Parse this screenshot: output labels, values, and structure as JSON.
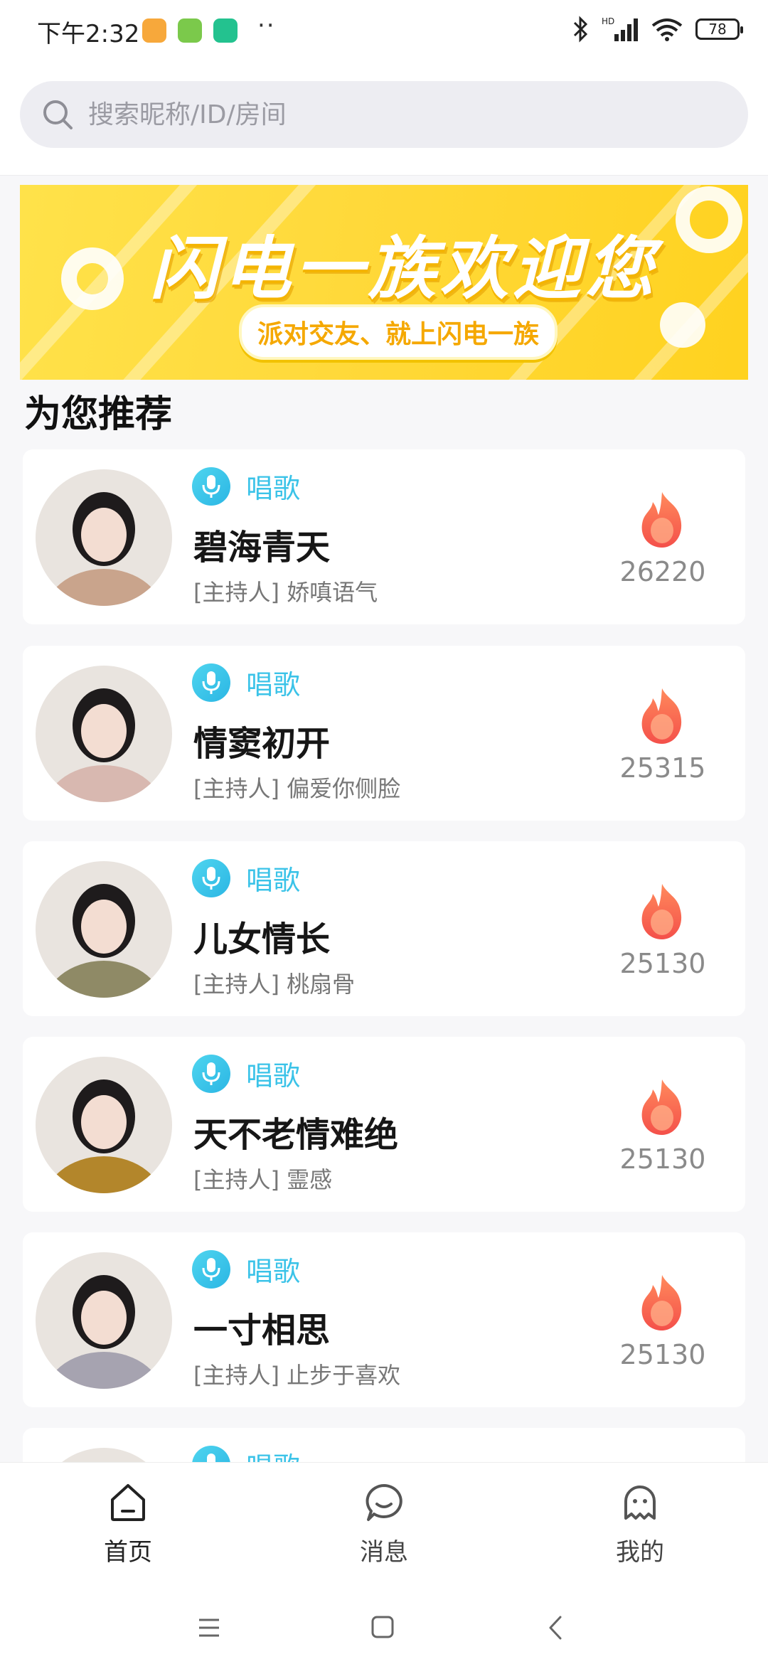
{
  "status_bar": {
    "time": "下午2:32",
    "battery": "78"
  },
  "search": {
    "placeholder": "搜索昵称/ID/房间"
  },
  "banner": {
    "title": "闪电一族欢迎您",
    "subtitle": "派对交友、就上闪电一族"
  },
  "section": {
    "title": "为您推荐"
  },
  "rooms": [
    {
      "tag": "唱歌",
      "name": "碧海青天",
      "host": "[主持人] 娇嗔语气",
      "hot": "26220",
      "avatar_color": "#c9a48c"
    },
    {
      "tag": "唱歌",
      "name": "情窦初开",
      "host": "[主持人] 偏爱你侧脸",
      "hot": "25315",
      "avatar_color": "#d8b8b0"
    },
    {
      "tag": "唱歌",
      "name": "儿女情长",
      "host": "[主持人] 桃扇骨",
      "hot": "25130",
      "avatar_color": "#8f8a66"
    },
    {
      "tag": "唱歌",
      "name": "天不老情难绝",
      "host": "[主持人] 霊感",
      "hot": "25130",
      "avatar_color": "#b3862b"
    },
    {
      "tag": "唱歌",
      "name": "一寸相思",
      "host": "[主持人] 止步于喜欢",
      "hot": "25130",
      "avatar_color": "#a6a3b0"
    },
    {
      "tag": "唱歌",
      "name": "",
      "host": "",
      "hot": "",
      "avatar_color": "#2b2f4a"
    }
  ],
  "tabs": [
    {
      "label": "首页",
      "icon": "home-icon",
      "active": true
    },
    {
      "label": "消息",
      "icon": "message-icon",
      "active": false
    },
    {
      "label": "我的",
      "icon": "profile-icon",
      "active": false
    }
  ],
  "colors": {
    "accent": "#3bc3e8",
    "banner": "#ffd93a",
    "fire": "#ff6a4d"
  }
}
